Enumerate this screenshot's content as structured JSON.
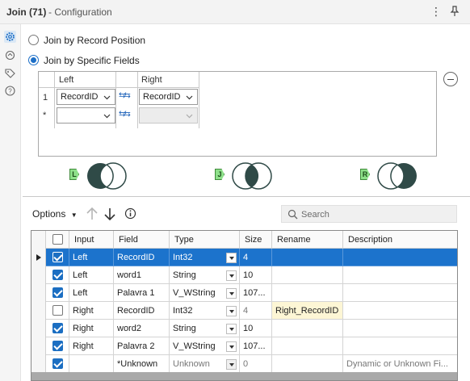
{
  "window": {
    "title": "Join (71)",
    "subtitle": "- Configuration",
    "more_icon": "more-vertical-icon",
    "pin_icon": "pin-icon"
  },
  "siderail": {
    "items": [
      {
        "icon": "gear-icon",
        "active": true
      },
      {
        "icon": "anchor-icon",
        "active": false
      },
      {
        "icon": "tag-icon",
        "active": false
      },
      {
        "icon": "help-icon",
        "active": false
      }
    ]
  },
  "join_mode": {
    "options": [
      {
        "label": "Join by Record Position",
        "selected": false
      },
      {
        "label": "Join by Specific Fields",
        "selected": true
      }
    ]
  },
  "join_fields": {
    "left_header": "Left",
    "right_header": "Right",
    "rows": [
      {
        "num": "1",
        "left": "RecordID",
        "right": "RecordID"
      },
      {
        "num": "*",
        "left": "",
        "right": ""
      }
    ]
  },
  "venn": [
    {
      "tag": "L",
      "name": "left-unjoined"
    },
    {
      "tag": "J",
      "name": "joined"
    },
    {
      "tag": "R",
      "name": "right-unjoined"
    }
  ],
  "toolbar": {
    "options_label": "Options",
    "search_placeholder": "Search"
  },
  "grid": {
    "columns": [
      "Input",
      "Field",
      "Type",
      "Size",
      "Rename",
      "Description"
    ],
    "rows": [
      {
        "checked": true,
        "input": "Left",
        "field": "RecordID",
        "type": "Int32",
        "size": "4",
        "rename": "",
        "description": "",
        "selected": true,
        "muted": false
      },
      {
        "checked": true,
        "input": "Left",
        "field": "word1",
        "type": "String",
        "size": "10",
        "rename": "",
        "description": "",
        "selected": false,
        "muted": false
      },
      {
        "checked": true,
        "input": "Left",
        "field": "Palavra 1",
        "type": "V_WString",
        "size": "107...",
        "rename": "",
        "description": "",
        "selected": false,
        "muted": false
      },
      {
        "checked": false,
        "input": "Right",
        "field": "RecordID",
        "type": "Int32",
        "size": "4",
        "rename": "Right_RecordID",
        "description": "",
        "selected": false,
        "muted": false
      },
      {
        "checked": true,
        "input": "Right",
        "field": "word2",
        "type": "String",
        "size": "10",
        "rename": "",
        "description": "",
        "selected": false,
        "muted": false
      },
      {
        "checked": true,
        "input": "Right",
        "field": "Palavra 2",
        "type": "V_WString",
        "size": "107...",
        "rename": "",
        "description": "",
        "selected": false,
        "muted": false
      },
      {
        "checked": true,
        "input": "",
        "field": "*Unknown",
        "type": "Unknown",
        "size": "0",
        "rename": "",
        "description": "Dynamic or Unknown Fi...",
        "selected": false,
        "muted": true
      }
    ]
  }
}
